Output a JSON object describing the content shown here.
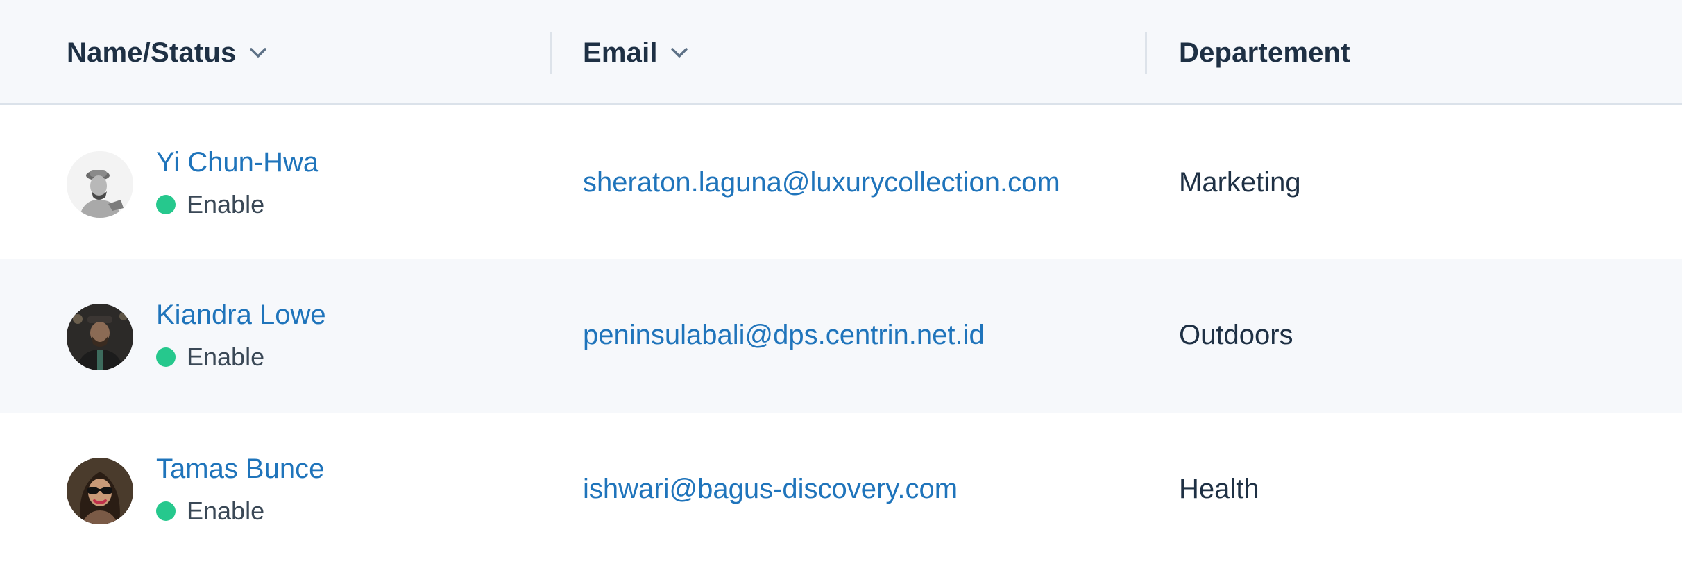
{
  "columns": {
    "name_status": "Name/Status",
    "email": "Email",
    "department": "Departement"
  },
  "colors": {
    "link": "#1f74bb",
    "status_enabled": "#26c88d",
    "header_bg": "#f6f8fb",
    "text_dark": "#1e3044"
  },
  "rows": [
    {
      "name": "Yi Chun-Hwa",
      "status": "Enable",
      "email": "sheraton.laguna@luxurycollection.com",
      "department": "Marketing"
    },
    {
      "name": "Kiandra Lowe",
      "status": "Enable",
      "email": "peninsulabali@dps.centrin.net.id",
      "department": "Outdoors"
    },
    {
      "name": "Tamas Bunce",
      "status": "Enable",
      "email": "ishwari@bagus-discovery.com",
      "department": "Health"
    }
  ]
}
